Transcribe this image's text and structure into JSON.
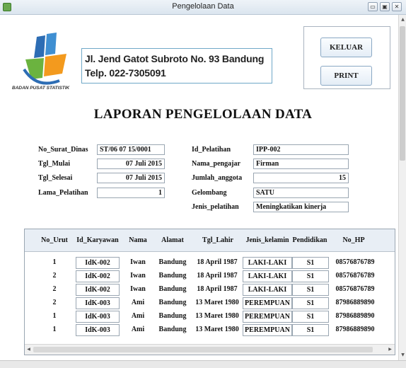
{
  "window": {
    "title": "Pengelolaan Data",
    "min_glyph": "▭",
    "max_glyph": "▣",
    "close_glyph": "✕"
  },
  "header": {
    "logo_caption": "BADAN PUSAT STATISTIK",
    "address_line1": "Jl. Jend Gatot Subroto No. 93 Bandung",
    "address_line2": "Telp. 022-7305091"
  },
  "actions": {
    "keluar": "KELUAR",
    "print": "PRINT"
  },
  "report": {
    "title": "LAPORAN PENGELOLAAN DATA"
  },
  "form": {
    "no_surat_dinas": {
      "label": "No_Surat_Dinas",
      "value": "ST/06 07 15/0001"
    },
    "tgl_mulai": {
      "label": "Tgl_Mulai",
      "value": "07 Juli 2015"
    },
    "tgl_selesai": {
      "label": "Tgl_Selesai",
      "value": "07 Juli 2015"
    },
    "lama_pelatihan": {
      "label": "Lama_Pelatihan",
      "value": "1"
    },
    "id_pelatihan": {
      "label": "Id_Pelatihan",
      "value": "IPP-002"
    },
    "nama_pengajar": {
      "label": "Nama_pengajar",
      "value": "Firman"
    },
    "jumlah_anggota": {
      "label": "Jumlah_anggota",
      "value": "15"
    },
    "gelombang": {
      "label": "Gelombang",
      "value": "SATU"
    },
    "jenis_pelatihan": {
      "label": "Jenis_pelatihan",
      "value": "Meningkatikan kinerja"
    }
  },
  "table": {
    "columns": [
      "No_Urut",
      "Id_Karyawan",
      "Nama",
      "Alamat",
      "Tgl_Lahir",
      "Jenis_kelamin",
      "Pendidikan",
      "No_HP"
    ],
    "rows": [
      [
        "1",
        "IdK-002",
        "Iwan",
        "Bandung",
        "18 April 1987",
        "LAKI-LAKI",
        "S1",
        "08576876789"
      ],
      [
        "2",
        "IdK-002",
        "Iwan",
        "Bandung",
        "18 April 1987",
        "LAKI-LAKI",
        "S1",
        "08576876789"
      ],
      [
        "2",
        "IdK-002",
        "Iwan",
        "Bandung",
        "18 April 1987",
        "LAKI-LAKI",
        "S1",
        "08576876789"
      ],
      [
        "2",
        "IdK-003",
        "Ami",
        "Bandung",
        "13 Maret 1980",
        "PEREMPUAN",
        "S1",
        "87986889890"
      ],
      [
        "1",
        "IdK-003",
        "Ami",
        "Bandung",
        "13 Maret 1980",
        "PEREMPUAN",
        "S1",
        "87986889890"
      ],
      [
        "1",
        "IdK-003",
        "Ami",
        "Bandung",
        "13 Maret 1980",
        "PEREMPUAN",
        "S1",
        "87986889890"
      ]
    ]
  },
  "scroll": {
    "up": "▲",
    "down": "▼",
    "left": "◀",
    "right": "▶"
  }
}
